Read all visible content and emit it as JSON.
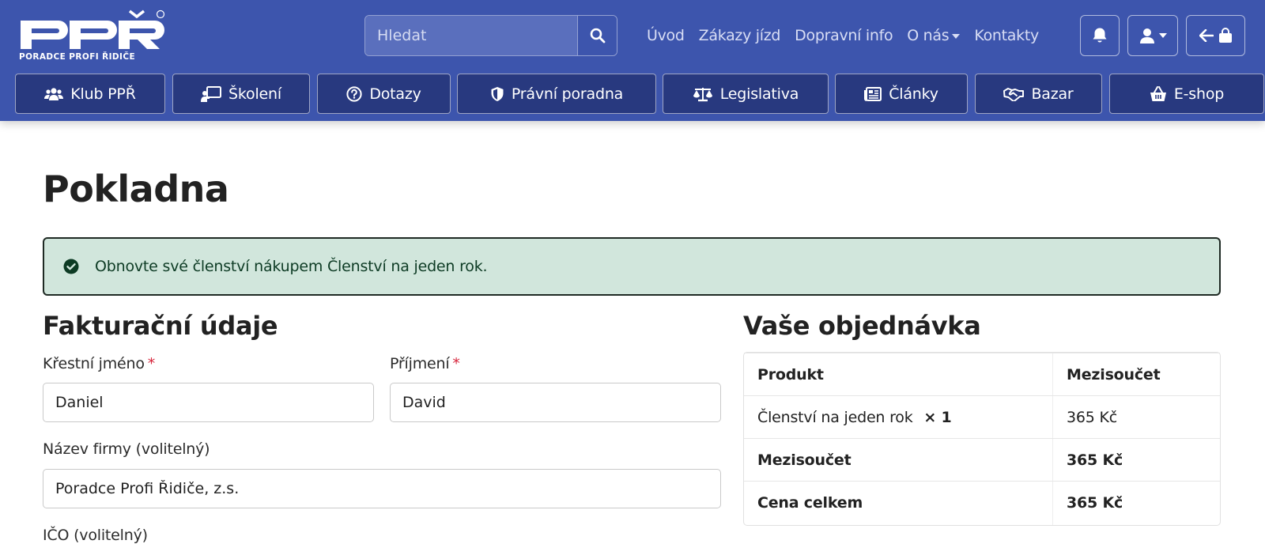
{
  "header": {
    "logo_text": "PPŘ",
    "logo_subtitle": "PORADCE PROFI ŘIDIČE",
    "search": {
      "placeholder": "Hledat"
    },
    "top_nav": [
      {
        "label": "Úvod"
      },
      {
        "label": "Zákazy jízd"
      },
      {
        "label": "Dopravní info"
      },
      {
        "label": "O nás",
        "has_dropdown": true
      },
      {
        "label": "Kontakty"
      }
    ],
    "icons": {
      "bell": "bell-icon",
      "user": "user-icon",
      "back_cart": "arrow-left-bag-icon"
    },
    "main_nav": [
      {
        "label": "Klub PPŘ",
        "icon": "users-icon"
      },
      {
        "label": "Školení",
        "icon": "teacher-icon"
      },
      {
        "label": "Dotazy",
        "icon": "question-circle-icon"
      },
      {
        "label": "Právní poradna",
        "icon": "shield-icon"
      },
      {
        "label": "Legislativa",
        "icon": "scales-icon"
      },
      {
        "label": "Články",
        "icon": "newspaper-icon"
      },
      {
        "label": "Bazar",
        "icon": "handshake-icon"
      },
      {
        "label": "E-shop",
        "icon": "basket-icon"
      }
    ],
    "colors": {
      "primary": "#3d55ad",
      "nav_button": "#28397f"
    }
  },
  "page": {
    "title": "Pokladna",
    "notice": {
      "text": "Obnovte své členství nákupem Členství na jeden rok.",
      "color": "#d1e6dc"
    }
  },
  "billing": {
    "title": "Fakturační údaje",
    "first_name": {
      "label": "Křestní jméno",
      "required": "*",
      "value": "Daniel"
    },
    "last_name": {
      "label": "Příjmení",
      "required": "*",
      "value": "David"
    },
    "company": {
      "label": "Název firmy (volitelný)",
      "value": "Poradce Profi Řidiče, z.s."
    },
    "ico": {
      "label": "IČO (volitelný)"
    }
  },
  "order": {
    "title": "Vaše objednávka",
    "columns": {
      "product": "Produkt",
      "subtotal": "Mezisoučet"
    },
    "items": [
      {
        "name": "Členství na jeden rok",
        "qty": "× 1",
        "price": "365 Kč"
      }
    ],
    "subtotal": {
      "label": "Mezisoučet",
      "value": "365 Kč"
    },
    "total": {
      "label": "Cena celkem",
      "value": "365 Kč"
    }
  }
}
